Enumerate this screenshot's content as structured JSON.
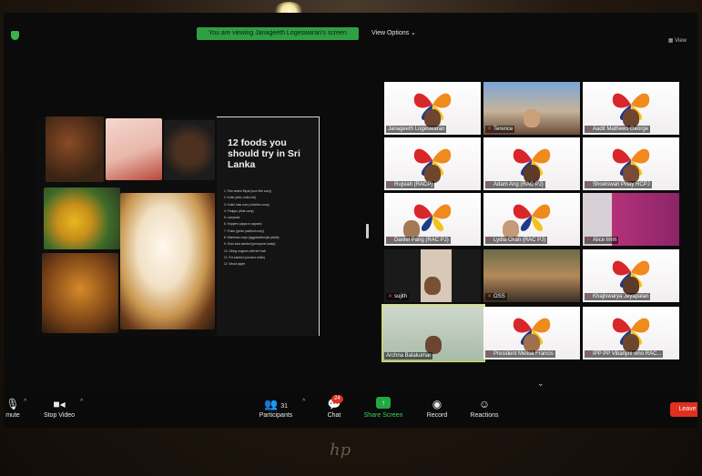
{
  "banner": {
    "text": "You are viewing Janageeth Logeswaran's screen"
  },
  "header": {
    "view_options": "View Options ⌄",
    "view_button": "View"
  },
  "shared_screen": {
    "title": "12 foods you should try in Sri Lanka",
    "items": [
      "1. Fish ambul thiyal (sour fish curry)",
      "2. Kottu (also, kottu roti)",
      "3. Kukul mas curry (chicken curry)",
      "4. Parippu (dhal curry)",
      "5. Lamprais",
      "6. Hoppers (appa or appam)",
      "7. Polos (green jackfruit curry)",
      "8. Wambatu moju (eggplant/brinjal pickle)",
      "9. Gotu kola sambol (pennywort salad)",
      "10. String hoppers with kiri hodi",
      "11. Pol sambol (coconut relish)",
      "12. Wood apple"
    ]
  },
  "participants": [
    {
      "name": "Janageeth Logeswaran",
      "muted": false
    },
    {
      "name": "Terence",
      "muted": true
    },
    {
      "name": "Aadit Mathews George",
      "muted": true
    },
    {
      "name": "Rujsiah (RACP)",
      "muted": true
    },
    {
      "name": "Adam Ang (RAC PJ)",
      "muted": true
    },
    {
      "name": "Shoeiswari Pillay RCPJ",
      "muted": true
    },
    {
      "name": "Daniel Pang (RAC PJ)",
      "muted": true
    },
    {
      "name": "Lydia Chan (RAC PJ)",
      "muted": true
    },
    {
      "name": "Alice Imm",
      "muted": true
    },
    {
      "name": "sujith",
      "muted": true
    },
    {
      "name": "OSS",
      "muted": true
    },
    {
      "name": "Khajlswarya Jeyapalan",
      "muted": true
    },
    {
      "name": "Archna Balakumar",
      "muted": false
    },
    {
      "name": "President Melisa Francis",
      "muted": true
    },
    {
      "name": "IPP PP Vibanjini vino RAC...",
      "muted": true
    }
  ],
  "toolbar": {
    "mute": "mute",
    "stop_video": "Stop Video",
    "participants": "Participants",
    "participants_count": "31",
    "chat": "Chat",
    "chat_badge": "24",
    "share_screen": "Share Screen",
    "record": "Record",
    "reactions": "Reactions",
    "leave": "Leave"
  },
  "colors": {
    "share_green": "#22a843",
    "leave_red": "#e0301e",
    "active_speaker": "#d9e23a",
    "banner_green": "#2ea043"
  },
  "icons": [
    "shield-icon",
    "mic-icon",
    "video-icon",
    "participants-icon",
    "chat-icon",
    "share-screen-icon",
    "record-icon",
    "reactions-icon",
    "chevron-down-icon"
  ]
}
